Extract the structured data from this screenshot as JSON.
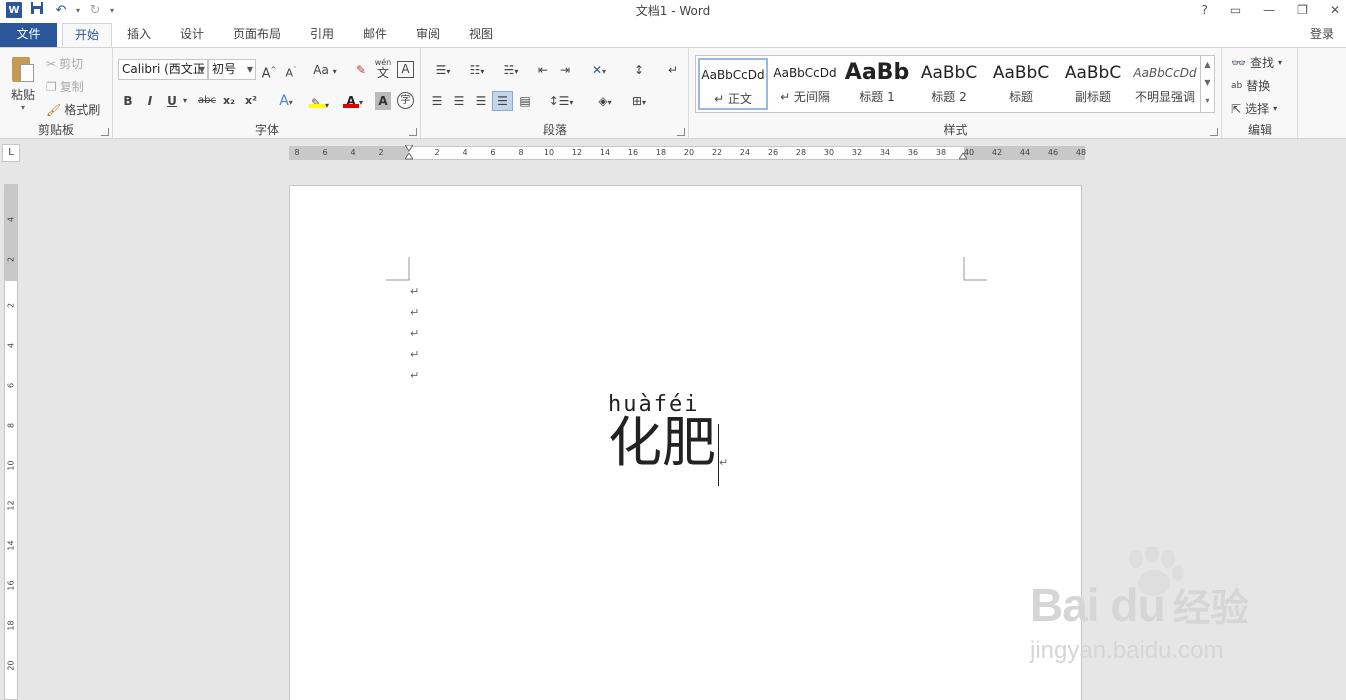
{
  "window": {
    "title": "文档1 - Word",
    "help": "?",
    "minimize": "—",
    "restore": "❐",
    "close": "✕",
    "login": "登录"
  },
  "qat": {
    "logo": "W",
    "save_icon": "floppy-disk-icon",
    "undo_icon": "undo-icon",
    "redo_icon": "redo-icon"
  },
  "tabs": [
    {
      "label": "文件"
    },
    {
      "label": "开始"
    },
    {
      "label": "插入"
    },
    {
      "label": "设计"
    },
    {
      "label": "页面布局"
    },
    {
      "label": "引用"
    },
    {
      "label": "邮件"
    },
    {
      "label": "审阅"
    },
    {
      "label": "视图"
    }
  ],
  "clipboard": {
    "paste": "粘贴",
    "cut": "剪切",
    "copy": "复制",
    "format_painter": "格式刷",
    "group": "剪贴板"
  },
  "font": {
    "name": "Calibri (西文正",
    "size": "初号",
    "grow": "A",
    "shrink": "A",
    "change_case": "Aa",
    "pinyin_top": "wén",
    "pinyin_bottom": "文",
    "border_char": "A",
    "bold": "B",
    "italic": "I",
    "underline": "U",
    "strike": "abc",
    "subscript": "x₂",
    "superscript": "x²",
    "text_effect": "A",
    "font_color": "A",
    "char_shading": "A",
    "enclose": "字",
    "group": "字体"
  },
  "paragraph": {
    "group": "段落"
  },
  "styles": {
    "items": [
      {
        "sample": "AaBbCcDd",
        "name": "↵ 正文"
      },
      {
        "sample": "AaBbCcDd",
        "name": "↵ 无间隔"
      },
      {
        "sample": "AaBb",
        "name": "标题 1"
      },
      {
        "sample": "AaBbC",
        "name": "标题 2"
      },
      {
        "sample": "AaBbC",
        "name": "标题"
      },
      {
        "sample": "AaBbC",
        "name": "副标题"
      },
      {
        "sample": "AaBbCcDd",
        "name": "不明显强调"
      }
    ],
    "group": "样式"
  },
  "editing": {
    "find": "查找",
    "replace": "替换",
    "select": "选择",
    "group": "编辑"
  },
  "ruler": {
    "corner": "L",
    "h_ticks": [
      "8",
      "6",
      "4",
      "2",
      "2",
      "4",
      "6",
      "8",
      "10",
      "12",
      "14",
      "16",
      "18",
      "20",
      "22",
      "24",
      "26",
      "28",
      "30",
      "32",
      "34",
      "36",
      "38",
      "40",
      "42",
      "44",
      "46",
      "48"
    ],
    "v_ticks": [
      "4",
      "2",
      "2",
      "4",
      "6",
      "8",
      "10",
      "12",
      "14",
      "16",
      "18",
      "20"
    ]
  },
  "document": {
    "para_mark": "↵",
    "pinyin": "huàféi",
    "text": "化肥"
  },
  "watermark": {
    "brand": "Bai du",
    "cn": "经验",
    "url": "jingyan.baidu.com"
  }
}
